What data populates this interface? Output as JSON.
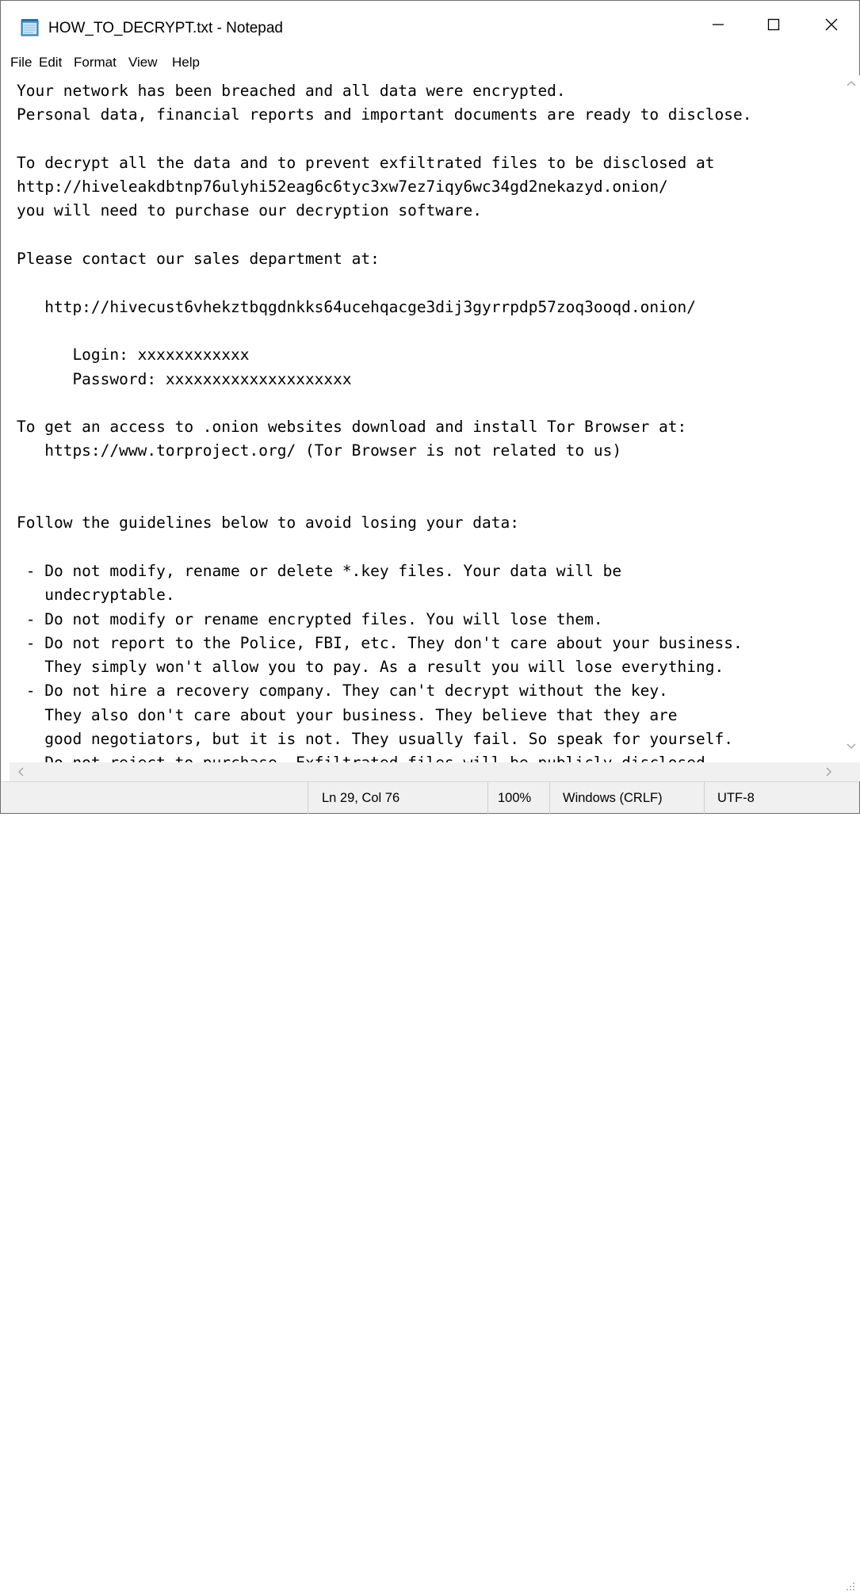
{
  "window": {
    "title": "HOW_TO_DECRYPT.txt - Notepad",
    "app_icon": "notepad-icon",
    "controls": [
      "minimize-icon",
      "maximize-icon",
      "close-icon"
    ]
  },
  "menu": {
    "items": [
      {
        "label": "File"
      },
      {
        "label": "Edit"
      },
      {
        "label": "Format"
      },
      {
        "label": "View"
      },
      {
        "label": "Help"
      }
    ]
  },
  "document": {
    "content": "Your network has been breached and all data were encrypted.\nPersonal data, financial reports and important documents are ready to disclose.\n\nTo decrypt all the data and to prevent exfiltrated files to be disclosed at\nhttp://hiveleakdbtnp76ulyhi52eag6c6tyc3xw7ez7iqy6wc34gd2nekazyd.onion/\nyou will need to purchase our decryption software.\n\nPlease contact our sales department at:\n\n   http://hivecust6vhekztbqgdnkks64ucehqacge3dij3gyrrpdp57zoq3ooqd.onion/\n\n      Login: xxxxxxxxxxxx\n      Password: xxxxxxxxxxxxxxxxxxxx\n\nTo get an access to .onion websites download and install Tor Browser at:\n   https://www.torproject.org/ (Tor Browser is not related to us)\n\n\nFollow the guidelines below to avoid losing your data:\n\n - Do not modify, rename or delete *.key files. Your data will be\n   undecryptable.\n - Do not modify or rename encrypted files. You will lose them.\n - Do not report to the Police, FBI, etc. They don't care about your business.\n   They simply won't allow you to pay. As a result you will lose everything.\n - Do not hire a recovery company. They can't decrypt without the key.\n   They also don't care about your business. They believe that they are\n   good negotiators, but it is not. They usually fail. So speak for yourself.\n - Do not reject to purchase. Exfiltrated files will be publicly disclosed."
  },
  "status": {
    "position": "Ln 29, Col 76",
    "zoom": "100%",
    "line_ending": "Windows (CRLF)",
    "encoding": "UTF-8"
  },
  "colors": {
    "chrome": "#f0f0f0",
    "text": "#000000",
    "border": "#6f6f6f"
  }
}
